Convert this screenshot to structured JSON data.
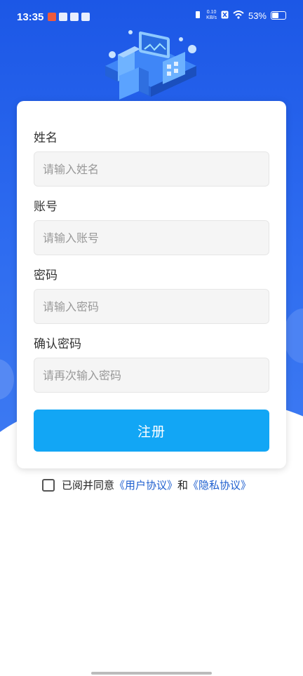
{
  "status_bar": {
    "time": "13:35",
    "net_speed_value": "0.10",
    "net_speed_unit": "KB/s",
    "battery": "53%"
  },
  "form": {
    "fields": [
      {
        "label": "姓名",
        "placeholder": "请输入姓名"
      },
      {
        "label": "账号",
        "placeholder": "请输入账号"
      },
      {
        "label": "密码",
        "placeholder": "请输入密码"
      },
      {
        "label": "确认密码",
        "placeholder": "请再次输入密码"
      }
    ],
    "submit_label": "注册"
  },
  "agreement": {
    "prefix": "已阅并同意",
    "user_agreement": "《用户协议》",
    "conjunction": "和",
    "privacy_policy": "《隐私协议》"
  },
  "colors": {
    "hero_blue": "#1c57e6",
    "button_blue": "#12a6f5",
    "link_blue": "#1e5fcf"
  }
}
